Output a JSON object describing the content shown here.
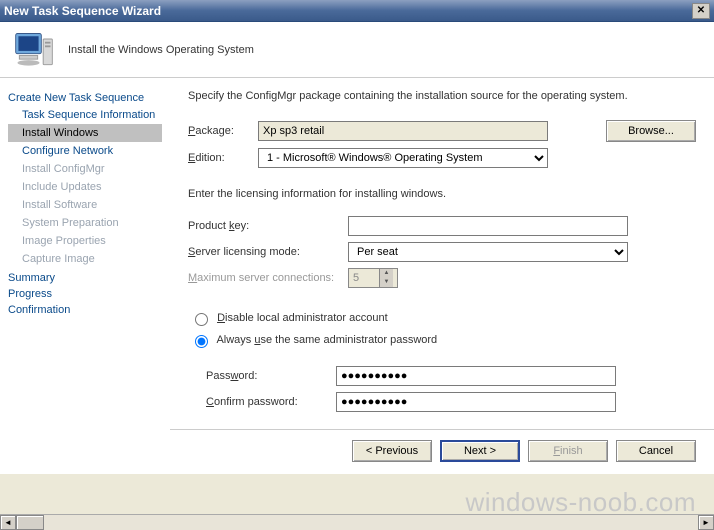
{
  "window": {
    "title": "New Task Sequence Wizard"
  },
  "header": {
    "subtitle": "Install the Windows Operating System"
  },
  "sidebar": {
    "group": "Create New Task Sequence",
    "steps": [
      {
        "label": "Task Sequence Information",
        "state": "normal"
      },
      {
        "label": "Install Windows",
        "state": "selected"
      },
      {
        "label": "Configure Network",
        "state": "normal"
      },
      {
        "label": "Install ConfigMgr",
        "state": "disabled"
      },
      {
        "label": "Include Updates",
        "state": "disabled"
      },
      {
        "label": "Install Software",
        "state": "disabled"
      },
      {
        "label": "System Preparation",
        "state": "disabled"
      },
      {
        "label": "Image Properties",
        "state": "disabled"
      },
      {
        "label": "Capture Image",
        "state": "disabled"
      }
    ],
    "tail": [
      "Summary",
      "Progress",
      "Confirmation"
    ]
  },
  "content": {
    "instruction": "Specify the ConfigMgr package containing the installation source for the operating system.",
    "package_label": "Package:",
    "package_value": "Xp sp3 retail",
    "browse": "Browse...",
    "edition_label": "Edition:",
    "edition_value": "1 - Microsoft® Windows® Operating System",
    "license_intro": "Enter the licensing information for installing windows.",
    "product_key_label": "Product key:",
    "product_key_value": "",
    "server_mode_label": "Server licensing mode:",
    "server_mode_value": "Per seat",
    "max_conn_label": "Maximum server connections:",
    "max_conn_value": "5",
    "radio_disable": "Disable local administrator account",
    "radio_same_pw": "Always use the same administrator password",
    "pw_label": "Password:",
    "pw_value": "●●●●●●●●●●",
    "cpw_label": "Confirm password:",
    "cpw_value": "●●●●●●●●●●"
  },
  "buttons": {
    "previous": "< Previous",
    "next": "Next >",
    "finish": "Finish",
    "cancel": "Cancel"
  },
  "watermark": "windows-noob.com"
}
